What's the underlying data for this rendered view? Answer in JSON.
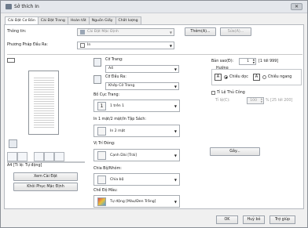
{
  "window": {
    "title": "Sở thích In",
    "close_glyph": "✕"
  },
  "tabs": [
    "Cài Đặt Cơ Bản",
    "Cài Đặt Trang",
    "Hoàn tất",
    "Nguồn Giấy",
    "Chất lượng"
  ],
  "top": {
    "info_label": "Thông tin:",
    "info_value": "Cài Đặt Mặc Định",
    "add_button": "Thêm(A)...",
    "edit_button": "Sửa(A)...",
    "output_label": "Phương Pháp Đầu Ra:",
    "output_value": "In"
  },
  "preview": {
    "caption": "A4 [Tỉ lệ: Tự động]",
    "view_settings_button": "Xem Cài Đặt",
    "restore_defaults_button": "Khôi Phục Mặc Định"
  },
  "middle": {
    "page_size_label": "Cỡ Trang:",
    "page_size_value": "A4",
    "output_size_label": "Cỡ Đầu Ra:",
    "output_size_value": "Khớp Cỡ Trang",
    "layout_label": "Bố Cục Trang:",
    "layout_value": "1 trên 1",
    "layout_icon_text": "1",
    "duplex_label": "In 1 mặt/2 mặt/In Tập Sách:",
    "duplex_value": "In 2 mặt",
    "binding_label": "Vị Trí Đóng:",
    "binding_value": "Cạnh Dài [Trái]",
    "collate_label": "Chia Bộ/Nhóm:",
    "collate_value": "Chia bộ",
    "color_label": "Chế Độ Màu:",
    "color_value": "Tự động [Màu/Đen Trắng]"
  },
  "right": {
    "copies_label": "Bản sao(Đ):",
    "copies_value": "1",
    "copies_range": "[1 tới 999]",
    "orientation_label": "Hướng",
    "portrait_label": "Chiều dọc",
    "landscape_label": "Chiều ngang",
    "manual_scale_label": "Tỉ Lệ Thủ Công",
    "scale_label": "Tỉ lệ(C):",
    "scale_value": "100",
    "scale_range": "% [25 tới 200]",
    "stamp_button": "Gây..."
  },
  "footer": {
    "ok": "OK",
    "cancel": "Huỷ bỏ",
    "help": "Trợ giúp"
  }
}
